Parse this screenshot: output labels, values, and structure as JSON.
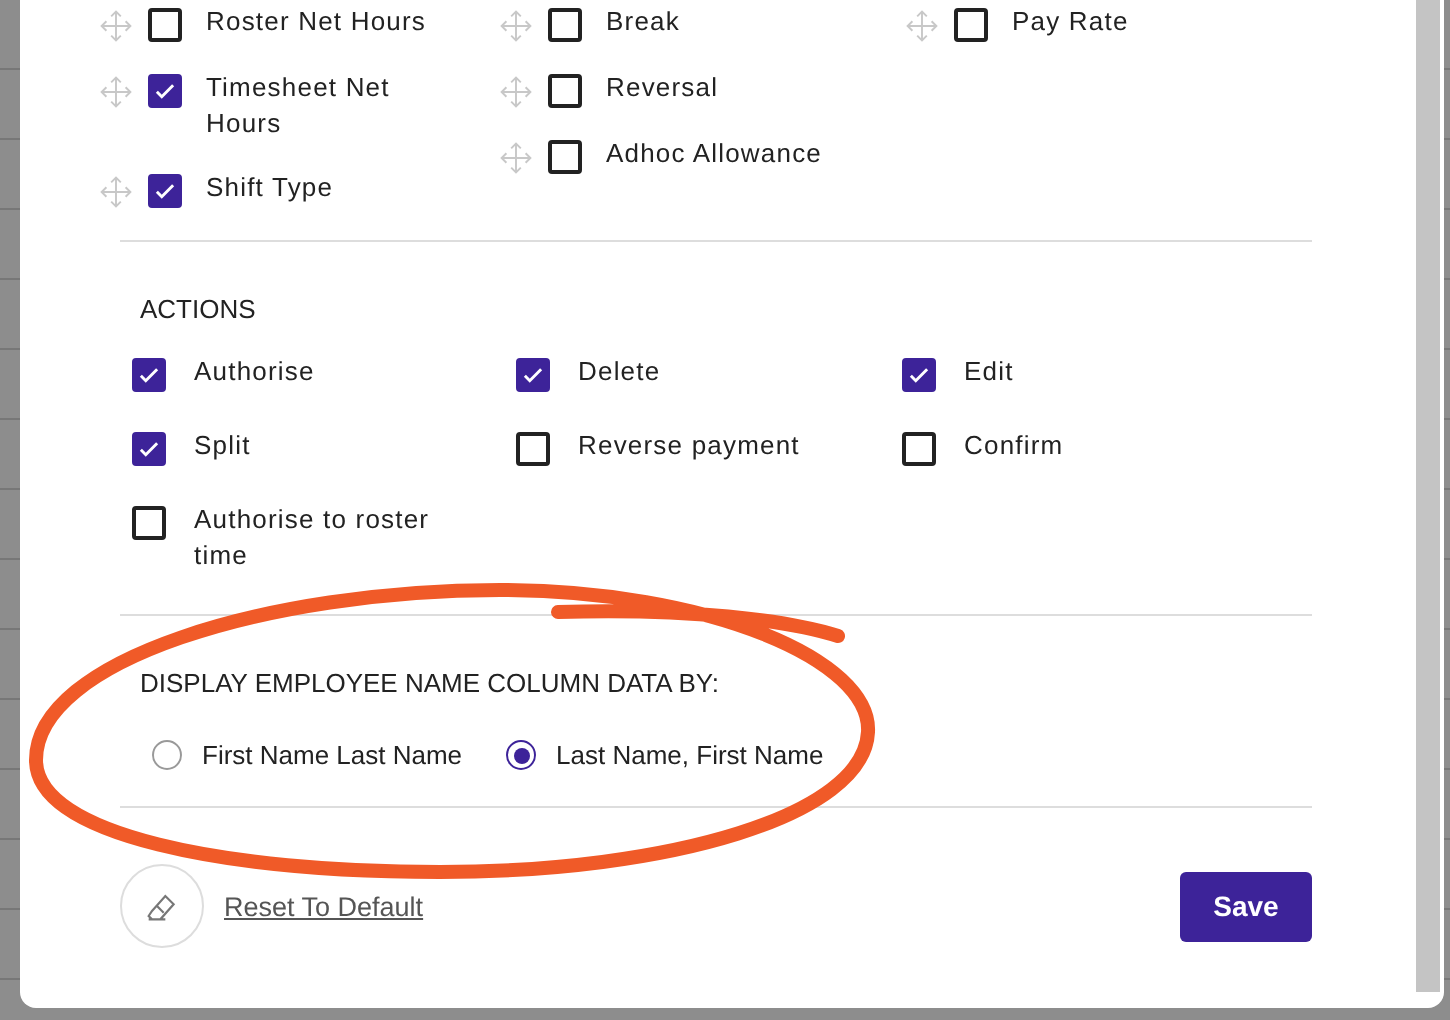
{
  "columns": [
    [
      {
        "label": "Roster Net Hours",
        "checked": false
      },
      {
        "label": "Timesheet Net Hours",
        "checked": true
      },
      {
        "label": "Shift Type",
        "checked": true
      }
    ],
    [
      {
        "label": "Break",
        "checked": false
      },
      {
        "label": "Reversal",
        "checked": false
      },
      {
        "label": "Adhoc Allowance",
        "checked": false
      }
    ],
    [
      {
        "label": "Pay Rate",
        "checked": false
      }
    ]
  ],
  "actions": {
    "title": "ACTIONS",
    "items": [
      {
        "label": "Authorise",
        "checked": true
      },
      {
        "label": "Delete",
        "checked": true
      },
      {
        "label": "Edit",
        "checked": true
      },
      {
        "label": "Split",
        "checked": true
      },
      {
        "label": "Reverse payment",
        "checked": false
      },
      {
        "label": "Confirm",
        "checked": false
      },
      {
        "label": "Authorise to roster time",
        "checked": false
      }
    ]
  },
  "name_display": {
    "title": "DISPLAY EMPLOYEE NAME COLUMN DATA BY:",
    "options": [
      {
        "label": "First Name Last Name",
        "selected": false
      },
      {
        "label": "Last Name, First Name",
        "selected": true
      }
    ]
  },
  "reset": "Reset To Default",
  "save": "Save"
}
